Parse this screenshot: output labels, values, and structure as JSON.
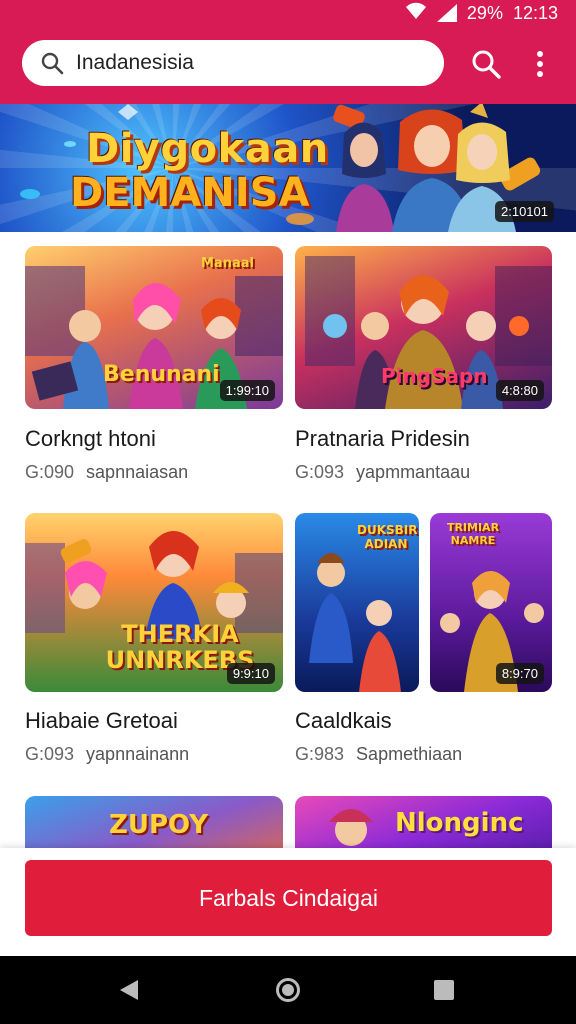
{
  "status_bar": {
    "battery": "29%",
    "time": "12:13"
  },
  "search": {
    "value": "Inadanesisia"
  },
  "banner": {
    "title_line1": "Diygokaan",
    "title_line2": "DEMANISA",
    "badge": "2:10101"
  },
  "cards": [
    {
      "thumb_text": "Benunani",
      "thumb_tag": "Manaal",
      "badge": "1:99:10",
      "title": "Corkngt htoni",
      "time": "G:090",
      "channel": "sapnnaiasan"
    },
    {
      "thumb_text": "PingSapn",
      "thumb_tag": "",
      "badge": "4:8:80",
      "title": "Pratnaria Pridesin",
      "time": "G:093",
      "channel": "yapmmantaau"
    },
    {
      "thumb_text": "THERKIA UNNRKEBS",
      "thumb_tag": "",
      "badge": "9:9:10",
      "title": "Hiabaie Gretoai",
      "time": "G:093",
      "channel": "yapnnainann"
    },
    {
      "thumb_text": "DUKSBIR ADIAN",
      "thumb_tag": "TRIMIAR NAMRE",
      "badge": "8:9:70",
      "title": "Caaldkais",
      "time": "G:983",
      "channel": "Sapmethiaan"
    },
    {
      "thumb_text": "ZUPOY",
      "thumb_tag": "",
      "badge": "",
      "title": "",
      "time": "",
      "channel": ""
    },
    {
      "thumb_text": "Nlonginc",
      "thumb_tag": "",
      "badge": "",
      "title": "",
      "time": "",
      "channel": ""
    }
  ],
  "cta": {
    "label": "Farbals Cindaigai"
  },
  "colors": {
    "brand": "#d81b55",
    "cta": "#e01e3c"
  }
}
